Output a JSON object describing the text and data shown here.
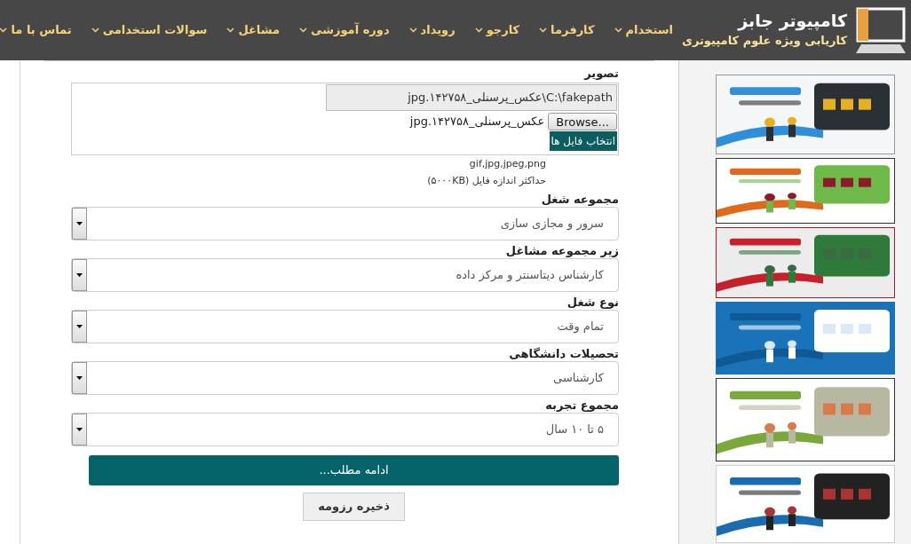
{
  "header": {
    "logo": {
      "title": "کامپیوتر جابز",
      "subtitle": "کاریابی ویژه علوم کامپیوتری"
    },
    "nav": [
      {
        "label": "استخدام"
      },
      {
        "label": "کارفرما"
      },
      {
        "label": "کارجو"
      },
      {
        "label": "رویداد"
      },
      {
        "label": "دوره آموزشی"
      },
      {
        "label": "مشاغل"
      },
      {
        "label": "سوالات استخدامی"
      },
      {
        "label": "تماس با ما"
      }
    ]
  },
  "form": {
    "image": {
      "label": "تصویر",
      "path": "C:\\fakepath\\عکس_پرسنلی_۱۴۲۷۵۸.jpg",
      "browse": "Browse...",
      "file_name": "عکس_پرسنلی_۱۴۲۷۵۸.jpg",
      "choose": "انتخاب فایل ها",
      "formats": "gif,jpg,jpeg,png",
      "max_size": "حداکثر اندازه فایل (۵۰۰۰KB)"
    },
    "selects": [
      {
        "label": "مجموعه شغل",
        "value": "سرور و مجازی سازی"
      },
      {
        "label": "زیر مجموعه مشاغل",
        "value": "کارشناس دیتاسنتر و مرکز داده"
      },
      {
        "label": "نوع شغل",
        "value": "تمام وقت"
      },
      {
        "label": "تحصیلات دانشگاهی",
        "value": "کارشناسی"
      },
      {
        "label": "مجموع تجربه",
        "value": "۵ تا ۱۰ سال"
      }
    ],
    "more": "ادامه مطلب...",
    "save": "ذخیره رزومه"
  }
}
